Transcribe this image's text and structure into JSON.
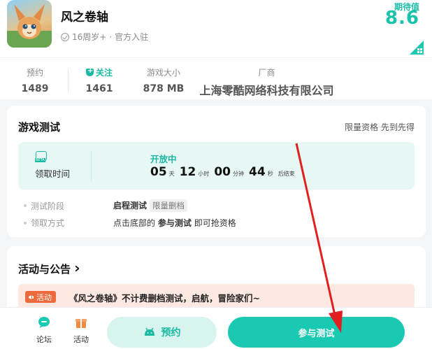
{
  "app": {
    "title": "风之卷轴",
    "age_rating": "16周岁+",
    "separator": "·",
    "official": "官方入驻",
    "expect_label": "期待值",
    "expect_score": "8.6"
  },
  "stats": {
    "reserve": {
      "label": "预约",
      "value": "1489"
    },
    "follow": {
      "label": "关注",
      "value": "1461"
    },
    "size": {
      "label": "游戏大小",
      "value": "878 MB"
    },
    "vendor": {
      "label": "厂商",
      "value": "上海零酷网络科技有限公司"
    }
  },
  "test": {
    "title": "游戏测试",
    "extra": "限量资格 先到先得",
    "receive_label": "领取时间",
    "status": "开放中",
    "countdown": {
      "days": "05",
      "days_unit": "天",
      "hours": "12",
      "hours_unit": "小时",
      "minutes": "00",
      "minutes_unit": "分钟",
      "seconds": "44",
      "seconds_unit": "秒",
      "suffix": "后结束"
    },
    "stage_label": "测试阶段",
    "stage_value": "启程测试",
    "stage_tag": "限量删档",
    "method_label": "领取方式",
    "method_prefix": "点击底部的",
    "method_bold": "参与测试",
    "method_suffix": "即可抢资格"
  },
  "activity": {
    "title": "活动与公告",
    "chevron": "›",
    "tag": "活动",
    "text": "《风之卷轴》不计费删档测试，启航，冒险家们~"
  },
  "bottom": {
    "forum": "论坛",
    "events": "活动",
    "reserve_button": "预约",
    "join_button": "参与测试"
  },
  "colors": {
    "accent": "#19c9b1",
    "accent_light": "#d8f4ef",
    "activity_orange": "#ef6a3b",
    "annotation_red": "#e02020"
  }
}
